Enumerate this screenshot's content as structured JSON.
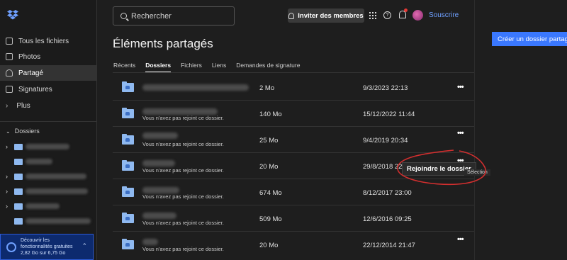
{
  "sidebar": {
    "nav": [
      {
        "label": "Tous les fichiers",
        "icon": "files-icon"
      },
      {
        "label": "Photos",
        "icon": "photos-icon"
      },
      {
        "label": "Partagé",
        "icon": "shared-icon"
      },
      {
        "label": "Signatures",
        "icon": "signature-icon"
      },
      {
        "label": "Plus",
        "icon": "chevron-right-icon"
      }
    ],
    "dossiers_label": "Dossiers",
    "promo": {
      "line1": "Découvrir les",
      "line2": "fonctionnalités gratuites",
      "storage": "2,82 Go sur 6,75 Go"
    }
  },
  "header": {
    "search_placeholder": "Rechercher",
    "invite_label": "Inviter des membres",
    "subscribe_label": "Souscrire"
  },
  "main": {
    "title": "Éléments partagés",
    "tabs": [
      "Récents",
      "Dossiers",
      "Fichiers",
      "Liens",
      "Demandes de signature"
    ],
    "create_button": "Créer un dossier partagé",
    "rows": [
      {
        "subtitle": "",
        "size": "2 Mo",
        "date": "9/3/2023 22:13"
      },
      {
        "subtitle": "Vous n'avez pas rejoint ce dossier.",
        "size": "140 Mo",
        "date": "15/12/2022 11:44"
      },
      {
        "subtitle": "Vous n'avez pas rejoint ce dossier.",
        "size": "25 Mo",
        "date": "9/4/2019 20:34"
      },
      {
        "subtitle": "Vous n'avez pas rejoint ce dossier.",
        "size": "20 Mo",
        "date": "29/8/2018 22:0"
      },
      {
        "subtitle": "Vous n'avez pas rejoint ce dossier.",
        "size": "674 Mo",
        "date": "8/12/2017 23:00"
      },
      {
        "subtitle": "Vous n'avez pas rejoint ce dossier.",
        "size": "509 Mo",
        "date": "12/6/2016 09:25"
      },
      {
        "subtitle": "Vous n'avez pas rejoint ce dossier.",
        "size": "20 Mo",
        "date": "22/12/2014 21:47"
      }
    ],
    "tooltip": "Rejoindre le dossier",
    "selection_tip": "Sélection"
  }
}
